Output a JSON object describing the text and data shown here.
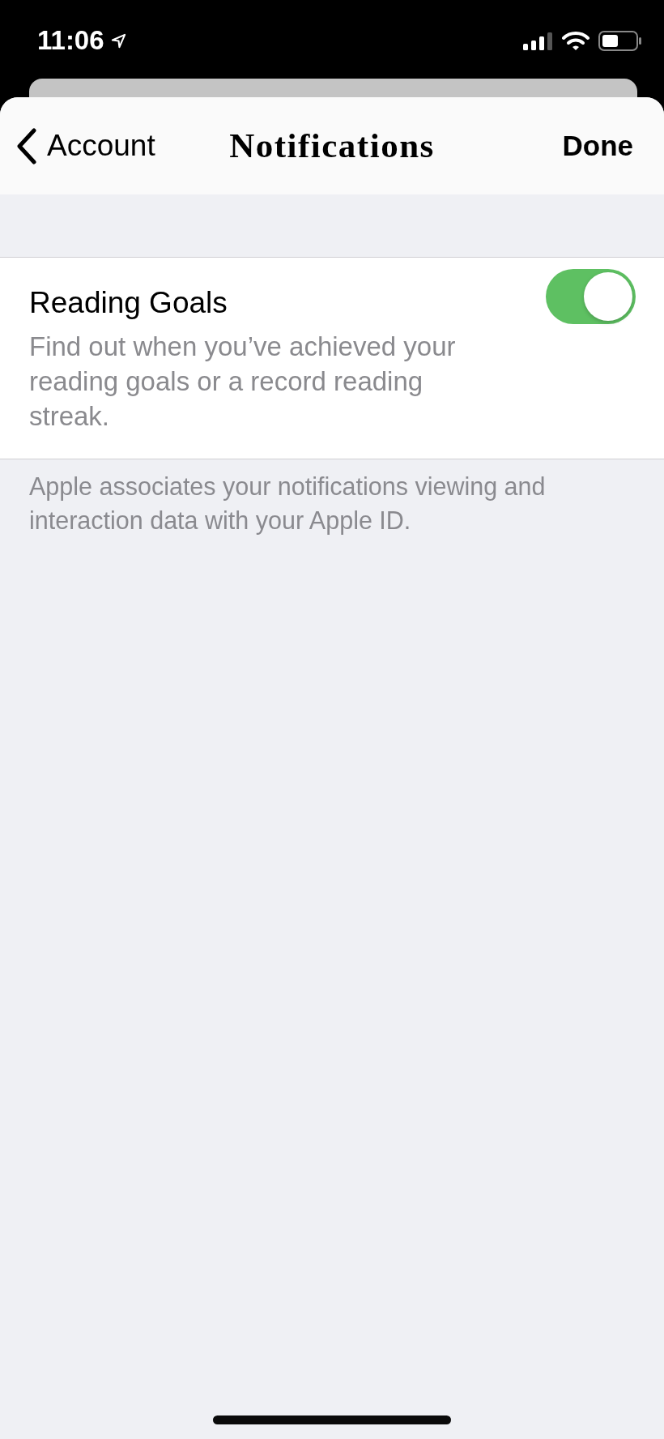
{
  "status_bar": {
    "time": "11:06"
  },
  "nav": {
    "back_label": "Account",
    "title": "Notifications",
    "done_label": "Done"
  },
  "settings": [
    {
      "title": "Reading Goals",
      "description": "Find out when you’ve achieved your reading goals or a record reading streak.",
      "on": true
    }
  ],
  "footer": "Apple associates your notifications viewing and interaction data with your Apple ID."
}
